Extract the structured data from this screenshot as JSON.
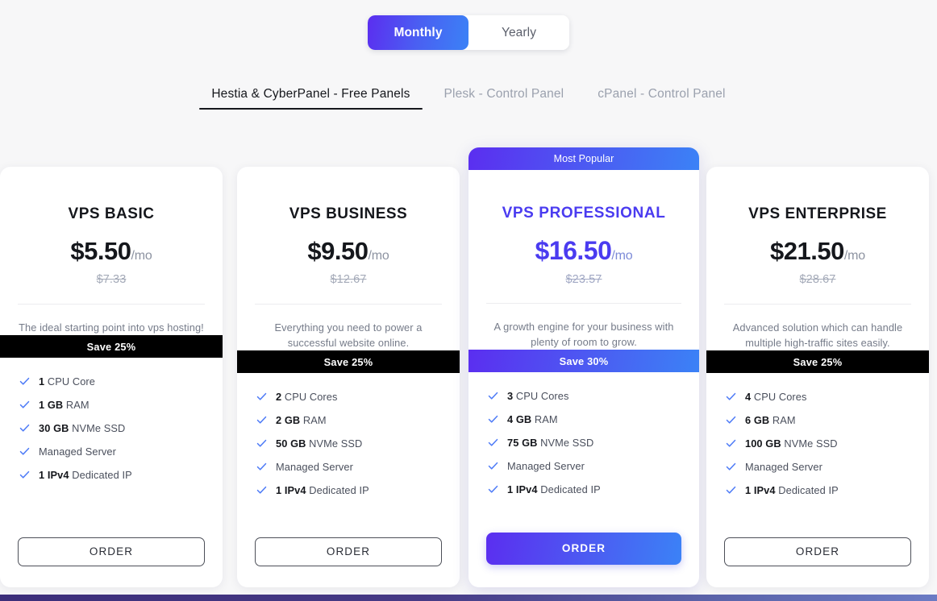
{
  "billing_toggle": {
    "options": [
      {
        "label": "Monthly",
        "active": true
      },
      {
        "label": "Yearly",
        "active": false
      }
    ]
  },
  "panel_tabs": [
    {
      "label": "Hestia & CyberPanel - Free Panels",
      "active": true
    },
    {
      "label": "Plesk - Control Panel",
      "active": false
    },
    {
      "label": "cPanel - Control Panel",
      "active": false
    }
  ],
  "colors": {
    "gradient_start": "#5b2ef0",
    "gradient_end": "#3b82f6",
    "featured_text": "#4a3bf0",
    "check_icon": "#4f7cf7",
    "save_banner_default": "#000000",
    "page_background": "#f7f7f8",
    "card_background": "#ffffff",
    "bottom_bar_start": "#3c2e7a",
    "bottom_bar_end": "#6b7bc4"
  },
  "plans": [
    {
      "name": "VPS BASIC",
      "price": "$5.50",
      "per": "/mo",
      "old_price": "$7.33",
      "tagline": "The ideal starting point into vps hosting!",
      "save_label": "Save 25%",
      "featured": false,
      "badge": null,
      "order_label": "ORDER",
      "features": [
        {
          "strong": "1",
          "rest": "CPU Core"
        },
        {
          "strong": "1 GB",
          "rest": "RAM"
        },
        {
          "strong": "30 GB",
          "rest": "NVMe SSD"
        },
        {
          "strong": "",
          "rest": "Managed Server"
        },
        {
          "strong": "1 IPv4",
          "rest": "Dedicated IP"
        }
      ]
    },
    {
      "name": "VPS BUSINESS",
      "price": "$9.50",
      "per": "/mo",
      "old_price": "$12.67",
      "tagline": "Everything you need to power a successful website online.",
      "save_label": "Save 25%",
      "featured": false,
      "badge": null,
      "order_label": "ORDER",
      "features": [
        {
          "strong": "2",
          "rest": "CPU Cores"
        },
        {
          "strong": "2 GB",
          "rest": "RAM"
        },
        {
          "strong": "50 GB",
          "rest": "NVMe SSD"
        },
        {
          "strong": "",
          "rest": "Managed Server"
        },
        {
          "strong": "1 IPv4",
          "rest": "Dedicated IP"
        }
      ]
    },
    {
      "name": "VPS PROFESSIONAL",
      "price": "$16.50",
      "per": "/mo",
      "old_price": "$23.57",
      "tagline": "A growth engine for your business with plenty of room to grow.",
      "save_label": "Save 30%",
      "featured": true,
      "badge": "Most Popular",
      "order_label": "ORDER",
      "features": [
        {
          "strong": "3",
          "rest": "CPU Cores"
        },
        {
          "strong": "4 GB",
          "rest": "RAM"
        },
        {
          "strong": "75 GB",
          "rest": "NVMe SSD"
        },
        {
          "strong": "",
          "rest": "Managed Server"
        },
        {
          "strong": "1 IPv4",
          "rest": "Dedicated IP"
        }
      ]
    },
    {
      "name": "VPS ENTERPRISE",
      "price": "$21.50",
      "per": "/mo",
      "old_price": "$28.67",
      "tagline": "Advanced solution which can handle multiple high-traffic sites easily.",
      "save_label": "Save 25%",
      "featured": false,
      "badge": null,
      "order_label": "ORDER",
      "features": [
        {
          "strong": "4",
          "rest": "CPU Cores"
        },
        {
          "strong": "6 GB",
          "rest": "RAM"
        },
        {
          "strong": "100 GB",
          "rest": "NVMe SSD"
        },
        {
          "strong": "",
          "rest": "Managed Server"
        },
        {
          "strong": "1 IPv4",
          "rest": "Dedicated IP"
        }
      ]
    }
  ]
}
